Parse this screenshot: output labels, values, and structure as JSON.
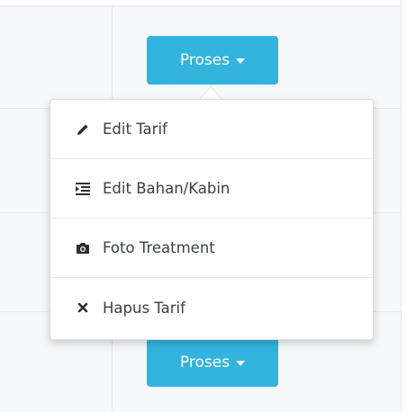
{
  "buttons": {
    "top_label": "Proses",
    "bottom_label": "Proses"
  },
  "menu": {
    "items": [
      {
        "label": "Edit Tarif",
        "icon": "pencil-icon"
      },
      {
        "label": "Edit Bahan/Kabin",
        "icon": "indent-list-icon"
      },
      {
        "label": "Foto Treatment",
        "icon": "camera-icon"
      },
      {
        "label": "Hapus Tarif",
        "icon": "close-icon"
      }
    ]
  },
  "colors": {
    "button_bg": "#32b4de",
    "button_text": "#ffffff",
    "menu_text": "#3a3f44"
  }
}
